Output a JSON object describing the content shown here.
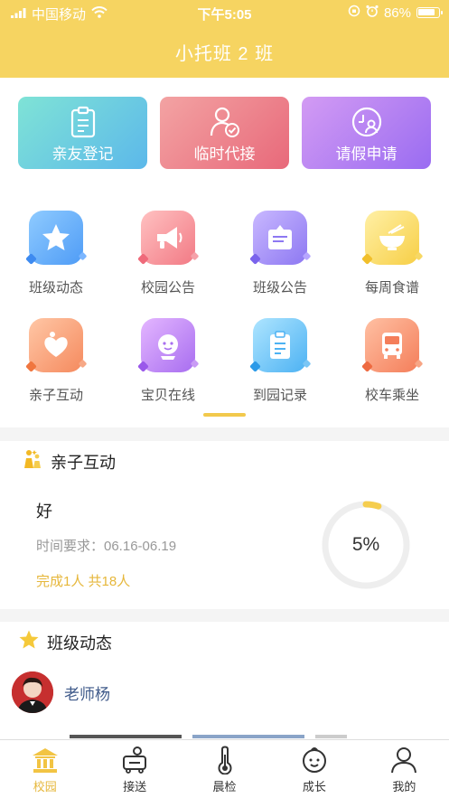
{
  "status": {
    "carrier": "中国移动",
    "time": "下午5:05",
    "battery": "86%"
  },
  "header": {
    "title": "小托班 2 班"
  },
  "quick_actions": [
    {
      "label": "亲友登记",
      "icon": "clipboard-icon"
    },
    {
      "label": "临时代接",
      "icon": "user-check-icon"
    },
    {
      "label": "请假申请",
      "icon": "clock-user-icon"
    }
  ],
  "grid": [
    {
      "label": "班级动态",
      "icon": "star-icon"
    },
    {
      "label": "校园公告",
      "icon": "megaphone-icon"
    },
    {
      "label": "班级公告",
      "icon": "notice-board-icon"
    },
    {
      "label": "每周食谱",
      "icon": "bowl-icon"
    },
    {
      "label": "亲子互动",
      "icon": "heart-hand-icon"
    },
    {
      "label": "宝贝在线",
      "icon": "baby-face-icon"
    },
    {
      "label": "到园记录",
      "icon": "record-clipboard-icon"
    },
    {
      "label": "校车乘坐",
      "icon": "bus-icon"
    }
  ],
  "interaction": {
    "section_title": "亲子互动",
    "task_title": "好",
    "time_requirement": "时间要求：06.16-06.19",
    "completion": "完成1人 共18人",
    "progress_label": "5%",
    "progress_value": 0.05
  },
  "class_news": {
    "section_title": "班级动态",
    "author": "老师杨"
  },
  "tabs": [
    {
      "label": "校园",
      "icon": "school-icon",
      "active": true
    },
    {
      "label": "接送",
      "icon": "pickup-icon",
      "active": false
    },
    {
      "label": "晨检",
      "icon": "thermometer-icon",
      "active": false
    },
    {
      "label": "成长",
      "icon": "baby-icon",
      "active": false
    },
    {
      "label": "我的",
      "icon": "person-icon",
      "active": false
    }
  ],
  "colors": {
    "header": "#f6d461",
    "accent": "#e6b73b",
    "ring_track": "#eeeeee"
  }
}
